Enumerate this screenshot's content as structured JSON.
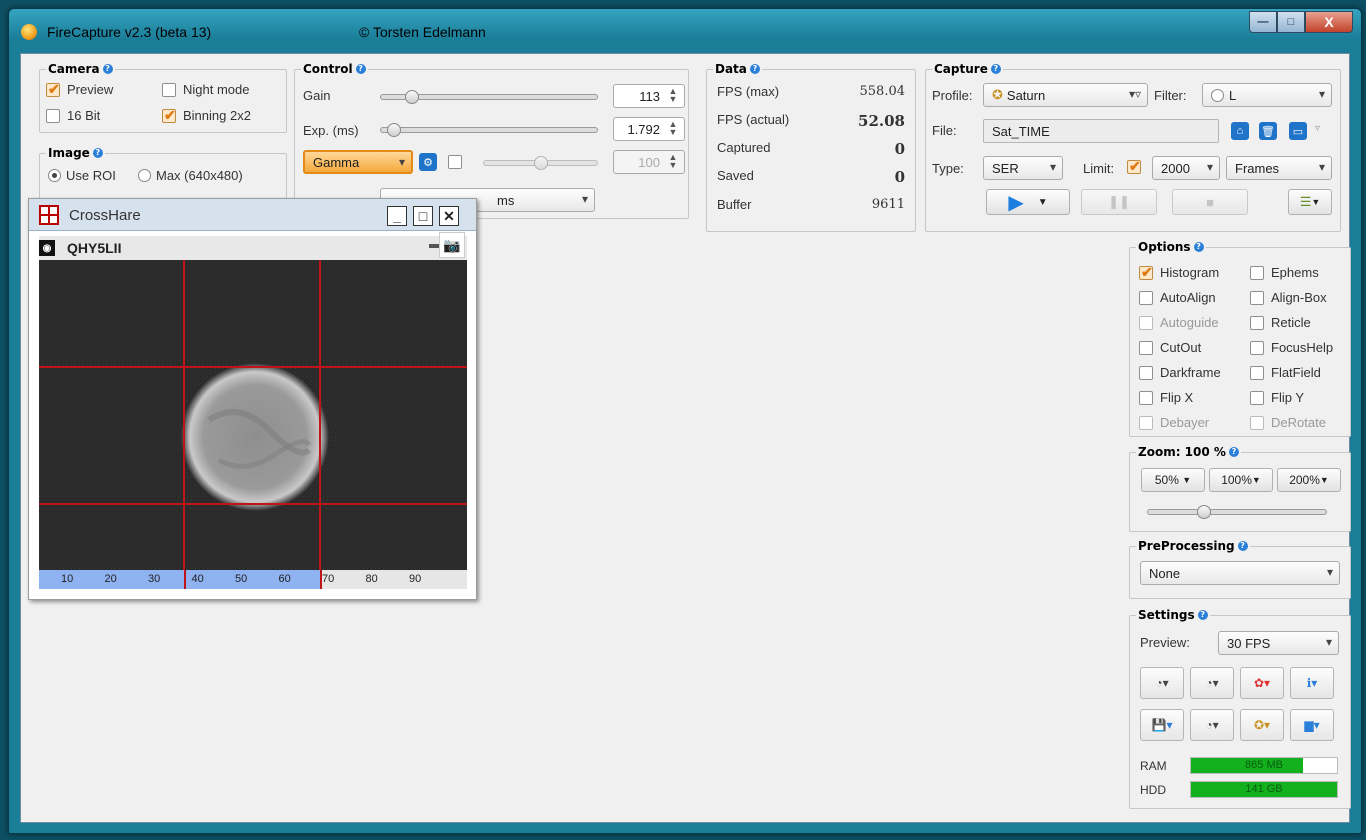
{
  "window": {
    "title": "FireCapture v2.3  (beta 13)",
    "copyright": "© Torsten Edelmann",
    "min": "—",
    "max": "□",
    "close": "X"
  },
  "camera": {
    "title": "Camera",
    "preview": "Preview",
    "night_mode": "Night mode",
    "bit16": "16 Bit",
    "binning": "Binning 2x2"
  },
  "image": {
    "title": "Image",
    "use_roi": "Use ROI",
    "max": "Max (640x480)"
  },
  "control": {
    "title": "Control",
    "gain_label": "Gain",
    "gain_value": "113",
    "gain_level": 0.12,
    "exp_label": "Exp. (ms)",
    "exp_value": "1.792",
    "exp_level": 0.03,
    "gamma_select": "Gamma",
    "gamma_value": "100",
    "gamma_level": 0.5,
    "partial_combo": "ms"
  },
  "data": {
    "title": "Data",
    "fps_max_label": "FPS (max)",
    "fps_max": "558.04",
    "fps_actual_label": "FPS (actual)",
    "fps_actual": "52.08",
    "captured_label": "Captured",
    "captured": "0",
    "saved_label": "Saved",
    "saved": "0",
    "buffer_label": "Buffer",
    "buffer": "9611"
  },
  "capture": {
    "title": "Capture",
    "profile_label": "Profile:",
    "profile": "Saturn",
    "filter_label": "Filter:",
    "filter": "L",
    "file_label": "File:",
    "file": "Sat_TIME",
    "type_label": "Type:",
    "type": "SER",
    "limit_label": "Limit:",
    "limit": "2000",
    "limit_unit": "Frames"
  },
  "options": {
    "title": "Options",
    "items": [
      {
        "label": "Histogram",
        "checked": true,
        "enabled": true
      },
      {
        "label": "Ephems",
        "checked": false,
        "enabled": true
      },
      {
        "label": "AutoAlign",
        "checked": false,
        "enabled": true
      },
      {
        "label": "Align-Box",
        "checked": false,
        "enabled": true
      },
      {
        "label": "Autoguide",
        "checked": false,
        "enabled": false
      },
      {
        "label": "Reticle",
        "checked": false,
        "enabled": true
      },
      {
        "label": "CutOut",
        "checked": false,
        "enabled": true
      },
      {
        "label": "FocusHelp",
        "checked": false,
        "enabled": true
      },
      {
        "label": "Darkframe",
        "checked": false,
        "enabled": true
      },
      {
        "label": "FlatField",
        "checked": false,
        "enabled": true
      },
      {
        "label": "Flip X",
        "checked": false,
        "enabled": true
      },
      {
        "label": "Flip Y",
        "checked": false,
        "enabled": true
      },
      {
        "label": "Debayer",
        "checked": false,
        "enabled": false
      },
      {
        "label": "DeRotate",
        "checked": false,
        "enabled": false
      }
    ]
  },
  "zoom": {
    "title": "Zoom: 100 %",
    "btn50": "50%",
    "btn100": "100%",
    "btn200": "200%",
    "level": 0.3
  },
  "preprocessing": {
    "title": "PreProcessing",
    "value": "None"
  },
  "settings": {
    "title": "Settings",
    "preview_label": "Preview:",
    "preview_value": "30 FPS",
    "ram_label": "RAM",
    "ram_value": "865 MB",
    "ram_fill": 0.77,
    "hdd_label": "HDD",
    "hdd_value": "141 GB",
    "hdd_fill": 1.0
  },
  "crosshare": {
    "title": "CrossHare",
    "camera_name": "QHY5LII",
    "ruler_ticks": [
      "10",
      "20",
      "30",
      "40",
      "50",
      "60",
      "70",
      "80",
      "90"
    ]
  }
}
